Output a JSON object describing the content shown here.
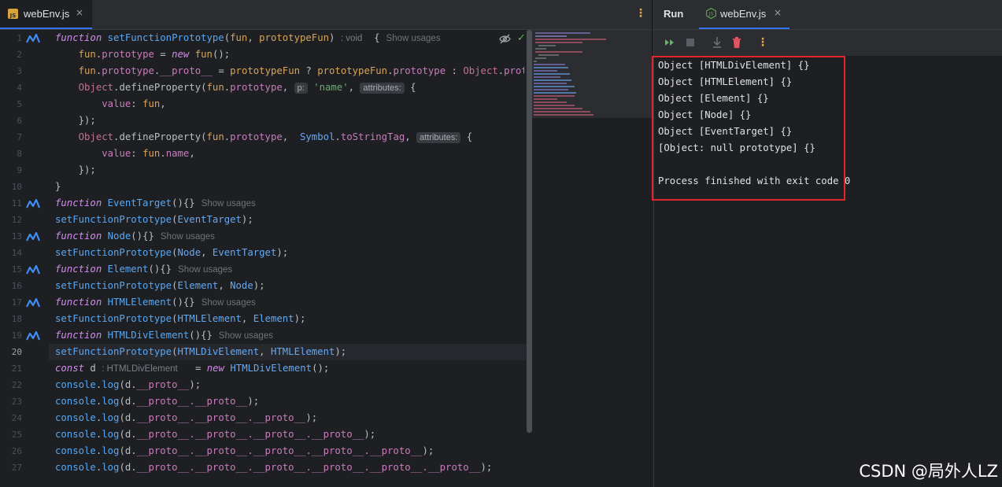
{
  "editor": {
    "tab": {
      "icon": "js-file-icon",
      "icon_text": "JS",
      "title": "webEnv.js",
      "close": "×"
    },
    "menu": "⋮",
    "line_numbers": [
      "1",
      "2",
      "3",
      "4",
      "5",
      "6",
      "7",
      "8",
      "9",
      "10",
      "11",
      "12",
      "13",
      "14",
      "15",
      "16",
      "17",
      "18",
      "19",
      "20",
      "21",
      "22",
      "23",
      "24",
      "25",
      "26",
      "27"
    ],
    "current_line": "20",
    "ai_gutter_lines": [
      "1",
      "11",
      "13",
      "15",
      "17",
      "19"
    ],
    "code": {
      "l1": {
        "kw": "function",
        "name": "setFunctionPrototype",
        "open": "(",
        "p1": "fun",
        "comma": ", ",
        "p2": "prototypeFun",
        "close": ")",
        "ret_hint": ": void",
        "brace": "{",
        "usages": "Show usages"
      },
      "l2": {
        "a": "fun",
        "b": ".",
        "c": "prototype",
        "d": " = ",
        "e": "new",
        "f": " ",
        "g": "fun",
        "h": "();"
      },
      "l3": {
        "a": "fun",
        "b": ".",
        "c": "prototype",
        "d": ".",
        "e": "__proto__",
        "f": " = ",
        "g": "prototypeFun",
        "h": " ? ",
        "i": "prototypeFun",
        "j": ".",
        "k": "prototype",
        "l": " : ",
        "m": "Object",
        "n": ".",
        "o": "prototype",
        "p": ";"
      },
      "l4": {
        "a": "Object",
        "b": ".defineProperty(",
        "c": "fun",
        "d": ".",
        "e": "prototype",
        "f": ", ",
        "g_hint": "p:",
        "h": "'name'",
        "i": ", ",
        "j_hint": "attributes:",
        "k": "{"
      },
      "l5": {
        "a": "value",
        "b": ": ",
        "c": "fun",
        "d": ","
      },
      "l6": {
        "a": "});"
      },
      "l7": {
        "a": "Object",
        "b": ".defineProperty(",
        "c": "fun",
        "d": ".",
        "e": "prototype",
        "f": ",  ",
        "g": "Symbol",
        "h": ".",
        "i": "toStringTag",
        "j": ", ",
        "k_hint": "attributes:",
        "l": "{"
      },
      "l8": {
        "a": "value",
        "b": ": ",
        "c": "fun",
        "d": ".",
        "e": "name",
        "f": ","
      },
      "l9": {
        "a": "});"
      },
      "l10": {
        "a": "}"
      },
      "l11": {
        "kw": "function",
        "name": "EventTarget",
        "rest": "(){}",
        "usages": "Show usages"
      },
      "l12": {
        "fn": "setFunctionPrototype",
        "o": "(",
        "a1": "EventTarget",
        "c": ");"
      },
      "l13": {
        "kw": "function",
        "name": "Node",
        "rest": "(){}",
        "usages": "Show usages"
      },
      "l14": {
        "fn": "setFunctionPrototype",
        "o": "(",
        "a1": "Node",
        "s": ", ",
        "a2": "EventTarget",
        "c": ");"
      },
      "l15": {
        "kw": "function",
        "name": "Element",
        "rest": "(){}",
        "usages": "Show usages"
      },
      "l16": {
        "fn": "setFunctionPrototype",
        "o": "(",
        "a1": "Element",
        "s": ", ",
        "a2": "Node",
        "c": ");"
      },
      "l17": {
        "kw": "function",
        "name": "HTMLElement",
        "rest": "(){}",
        "usages": "Show usages"
      },
      "l18": {
        "fn": "setFunctionPrototype",
        "o": "(",
        "a1": "HTMLElement",
        "s": ", ",
        "a2": "Element",
        "c": ");"
      },
      "l19": {
        "kw": "function",
        "name": "HTMLDivElement",
        "rest": "(){}",
        "usages": "Show usages"
      },
      "l20": {
        "fn": "setFunctionPrototype",
        "o": "(",
        "a1": "HTMLDivElement",
        "s": ", ",
        "a2": "HTMLElement",
        "c": ");"
      },
      "l21": {
        "kw": "const",
        "v": " d ",
        "hint": ": HTMLDivElement",
        "eq": " = ",
        "new": "new",
        "cls": " HTMLDivElement",
        "end": "();"
      },
      "l22": {
        "a": "console",
        "b": ".",
        "c": "log",
        "d": "(d.",
        "e": "__proto__",
        "f": ");"
      },
      "l23": {
        "a": "console",
        "b": ".",
        "c": "log",
        "d": "(d.",
        "e": "__proto__.__proto__",
        "f": ");"
      },
      "l24": {
        "a": "console",
        "b": ".",
        "c": "log",
        "d": "(d.",
        "e": "__proto__.__proto__.__proto__",
        "f": ");"
      },
      "l25": {
        "a": "console",
        "b": ".",
        "c": "log",
        "d": "(d.",
        "e": "__proto__.__proto__.__proto__.__proto__",
        "f": ");"
      },
      "l26": {
        "a": "console",
        "b": ".",
        "c": "log",
        "d": "(d.",
        "e": "__proto__.__proto__.__proto__.__proto__.__proto__",
        "f": ");"
      },
      "l27": {
        "a": "console",
        "b": ".",
        "c": "log",
        "d": "(d.",
        "e": "__proto__.__proto__.__proto__.__proto__.__proto__.__proto__",
        "f": ");"
      }
    },
    "inline_icons": {
      "hide": "eye-off-icon",
      "check": "✓"
    }
  },
  "run_panel": {
    "title": "Run",
    "tab": {
      "icon": "nodejs-icon",
      "title": "webEnv.js",
      "close": "×"
    },
    "toolbar": {
      "rerun": "rerun-icon",
      "stop": "stop-icon",
      "scroll": "scroll-to-end-icon",
      "clear": "trash-icon",
      "more": "⋮"
    },
    "output": [
      "Object [HTMLDivElement] {}",
      "Object [HTMLElement] {}",
      "Object [Element] {}",
      "Object [Node] {}",
      "Object [EventTarget] {}",
      "[Object: null prototype] {}",
      "",
      "Process finished with exit code 0"
    ]
  },
  "watermark": "CSDN @局外人LZ",
  "colors": {
    "accent": "#3574f0",
    "highlight_box": "#e0262a",
    "keyword": "#cf8ee9",
    "function": "#56a8f5"
  }
}
